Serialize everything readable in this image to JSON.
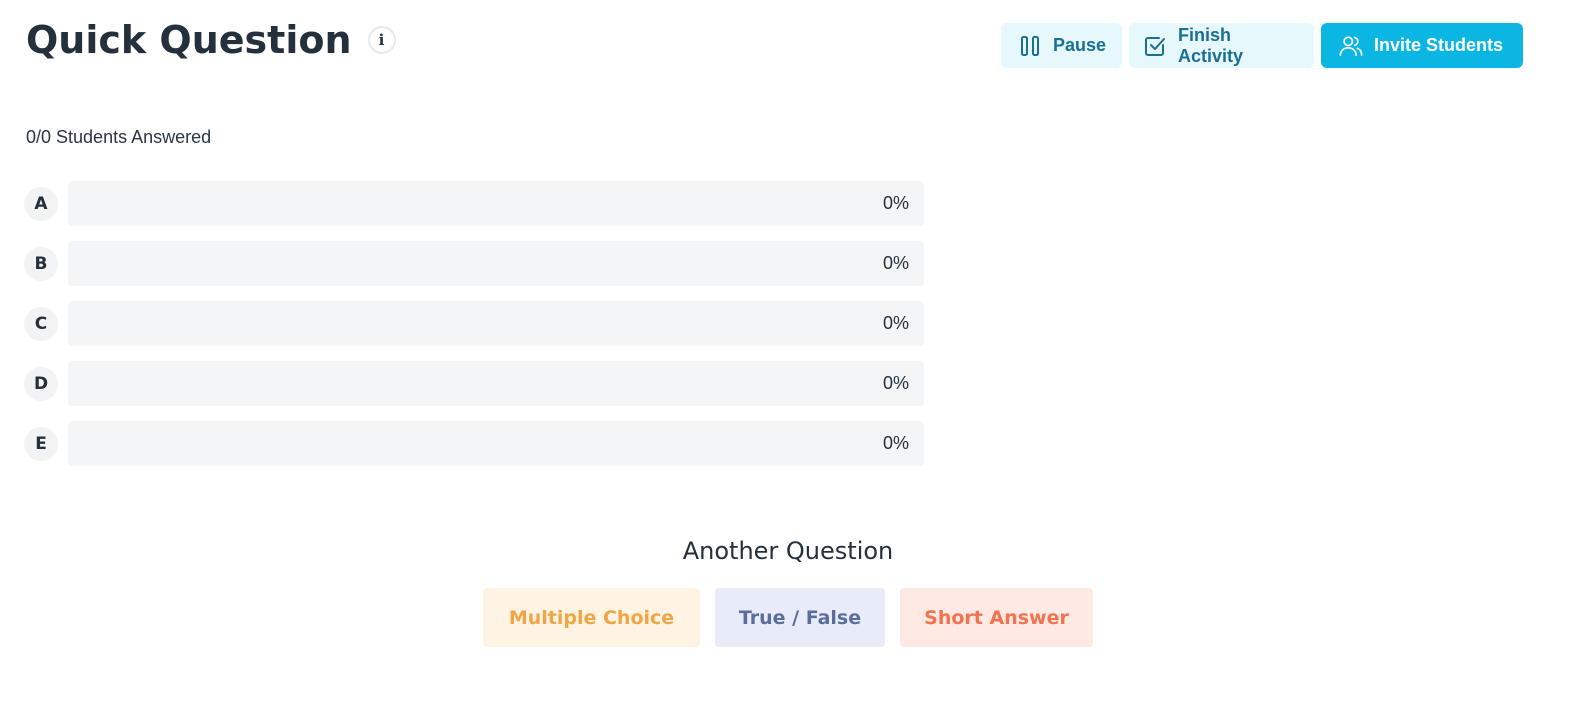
{
  "header": {
    "title": "Quick Question",
    "info_icon": "info-icon",
    "info_glyph": "i"
  },
  "toolbar": {
    "pause_label": "Pause",
    "pause_icon": "pause-icon",
    "finish_label": "Finish Activity",
    "finish_icon": "checkbox-icon",
    "invite_label": "Invite Students",
    "invite_icon": "users-icon"
  },
  "status": {
    "answered_text": "0/0 Students Answered"
  },
  "answers": [
    {
      "letter": "A",
      "percent_text": "0%",
      "fraction": 0
    },
    {
      "letter": "B",
      "percent_text": "0%",
      "fraction": 0
    },
    {
      "letter": "C",
      "percent_text": "0%",
      "fraction": 0
    },
    {
      "letter": "D",
      "percent_text": "0%",
      "fraction": 0
    },
    {
      "letter": "E",
      "percent_text": "0%",
      "fraction": 0
    }
  ],
  "another": {
    "heading": "Another Question",
    "multiple_choice_label": "Multiple Choice",
    "true_false_label": "True / False",
    "short_answer_label": "Short Answer"
  },
  "colors": {
    "primary": "#0bb6e3",
    "light_button_bg": "#e6f8fc",
    "light_button_text": "#1a6f95",
    "title_text": "#24303c",
    "bar_bg": "#f4f5f7",
    "multiple_choice": "#f0a646",
    "true_false": "#5b6d9c",
    "short_answer": "#f2734e"
  }
}
